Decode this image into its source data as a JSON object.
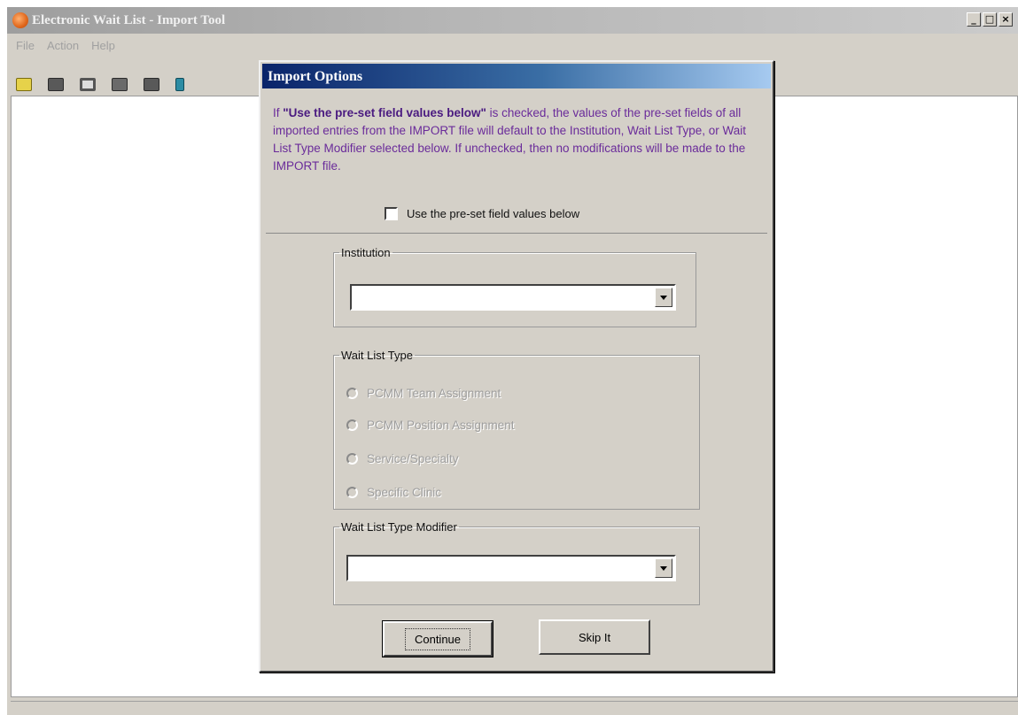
{
  "app": {
    "title": "Electronic Wait List - Import Tool",
    "window_controls": {
      "minimize": "_",
      "maximize": "□",
      "close": "×"
    },
    "menu": [
      {
        "label": "File"
      },
      {
        "label": "Action"
      },
      {
        "label": "Help"
      }
    ],
    "toolbar": [
      {
        "icon": "folder-icon"
      },
      {
        "icon": "open-icon"
      },
      {
        "icon": "monitor-icon"
      },
      {
        "icon": "floppy-icon"
      },
      {
        "icon": "print-icon"
      },
      {
        "icon": "import-icon"
      }
    ]
  },
  "dialog": {
    "title": "Import Options",
    "info": {
      "prefix": "If ",
      "highlight": "\"Use the pre-set field values below\"",
      "rest": " is checked, the values of the pre-set fields of all imported entries from the IMPORT file will default to the Institution, Wait List Type, or Wait List Type Modifier selected below. If unchecked, then no modifications will be made to the IMPORT file."
    },
    "use_preset": {
      "label": "Use the pre-set field values below",
      "checked": false
    },
    "institution": {
      "label": "Institution",
      "value": ""
    },
    "wait_list_type": {
      "label": "Wait List Type",
      "options": [
        {
          "label": "PCMM Team Assignment",
          "selected": false
        },
        {
          "label": "PCMM Position Assignment",
          "selected": false
        },
        {
          "label": "Service/Specialty",
          "selected": false
        },
        {
          "label": "Specific Clinic",
          "selected": false
        }
      ]
    },
    "modifier": {
      "label": "Wait List Type Modifier",
      "value": ""
    },
    "buttons": {
      "continue": "Continue",
      "skip": "Skip It"
    }
  },
  "colors": {
    "dialog_title_gradient": [
      "#0a246a",
      "#a6caf0"
    ],
    "info_text": "#6a2b9a",
    "window_face": "#d4d0c8"
  }
}
